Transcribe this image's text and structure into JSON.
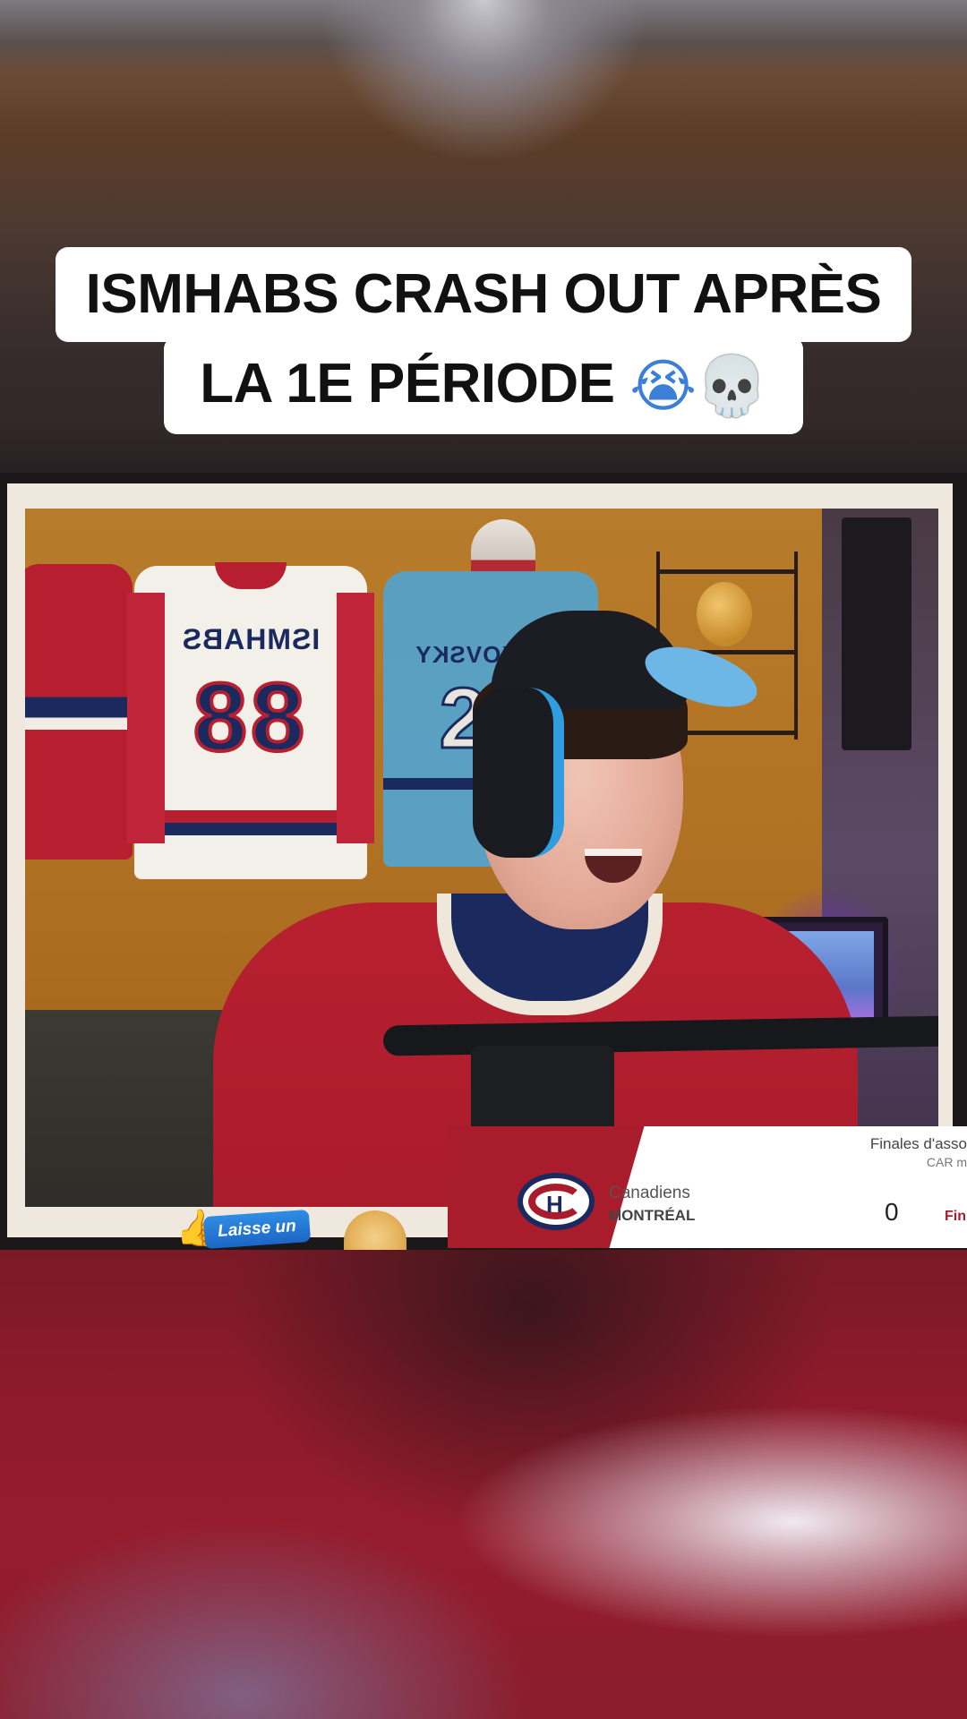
{
  "caption": {
    "line1": "ISMHABS CRASH OUT APRÈS",
    "line2": "LA 1E PÉRIODE",
    "emoji1": "😭",
    "emoji2": "💀"
  },
  "stream": {
    "jerseys": [
      {
        "name": "ISMHABS",
        "number": "88"
      },
      {
        "name": "LAFKOVSKY",
        "number": "20"
      }
    ],
    "sticker": {
      "label": "Laisse un"
    }
  },
  "scoreboard": {
    "header": "Finales d'asso",
    "subheader": "CAR m",
    "team_name": "Canadiens",
    "team_city": "MONTRÉAL",
    "score": "0",
    "status": "Fin",
    "colors": {
      "primary": "#a91c2c",
      "secondary": "#1b2a5e"
    }
  }
}
